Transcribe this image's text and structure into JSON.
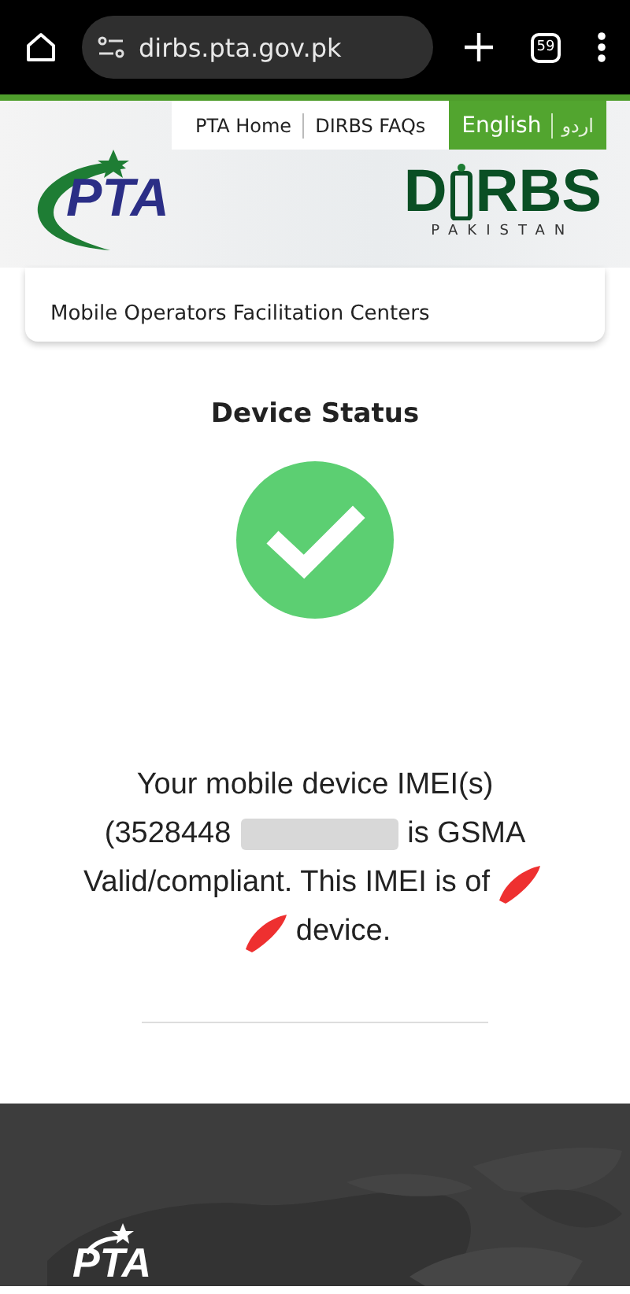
{
  "browser": {
    "url": "dirbs.pta.gov.pk",
    "tab_count": "59"
  },
  "top_nav": {
    "links": [
      {
        "label": "PTA Home"
      },
      {
        "label": "DIRBS FAQs"
      }
    ],
    "languages": [
      {
        "label": "English",
        "selected": true
      },
      {
        "label": "اردو",
        "selected": false
      }
    ]
  },
  "header": {
    "pta_logo": "PTA",
    "dirbs_logo": {
      "left": "D",
      "right": "RBS",
      "subtitle": "PAKISTAN"
    }
  },
  "menu_card": {
    "items": [
      "Mobile Operators Facilitation Centers"
    ]
  },
  "status": {
    "title": "Device Status",
    "valid": true,
    "lines": [
      [
        {
          "kind": "text",
          "text": "Your mobile device IMEI(s)"
        }
      ],
      [
        {
          "kind": "text",
          "text": "(3528448"
        },
        {
          "kind": "blur"
        },
        {
          "kind": "text",
          "text": "is GSMA"
        }
      ],
      [
        {
          "kind": "text",
          "text": "Valid/compliant. This IMEI is of"
        },
        {
          "kind": "scribble"
        }
      ],
      [
        {
          "kind": "scribble"
        },
        {
          "kind": "text",
          "text": "device."
        }
      ]
    ]
  },
  "footer": {
    "logo": "PTA"
  }
}
